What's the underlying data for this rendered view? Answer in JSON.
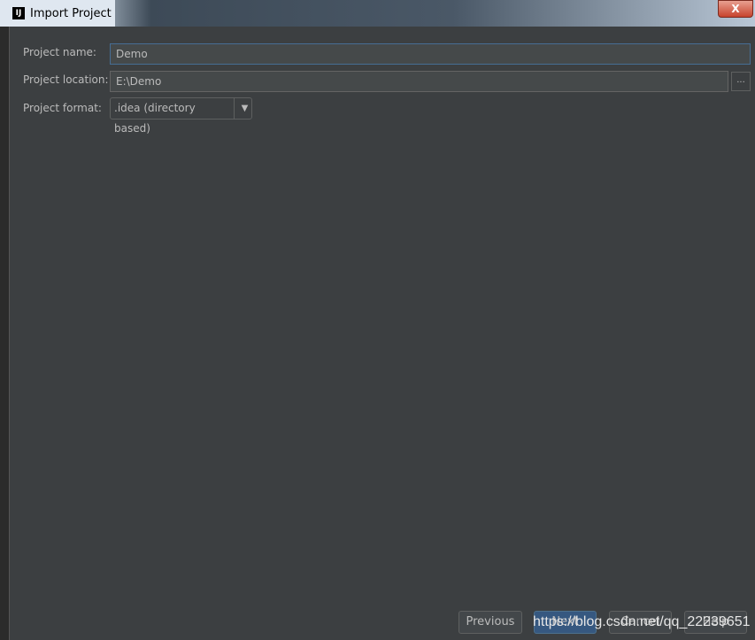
{
  "window": {
    "title": "Import Project",
    "app_icon": "IJ",
    "close_label": "X"
  },
  "form": {
    "name_label": "Project name:",
    "name_value": "Demo",
    "location_label": "Project location:",
    "location_value": "E:\\Demo",
    "browse_label": "...",
    "format_label": "Project format:",
    "format_value": ".idea (directory based)",
    "format_arrow": "▼"
  },
  "buttons": {
    "previous": "Previous",
    "next": "Next",
    "cancel": "Cancel",
    "help": "Help"
  },
  "watermark": "https://blog.csdn.net/qq_22239651"
}
